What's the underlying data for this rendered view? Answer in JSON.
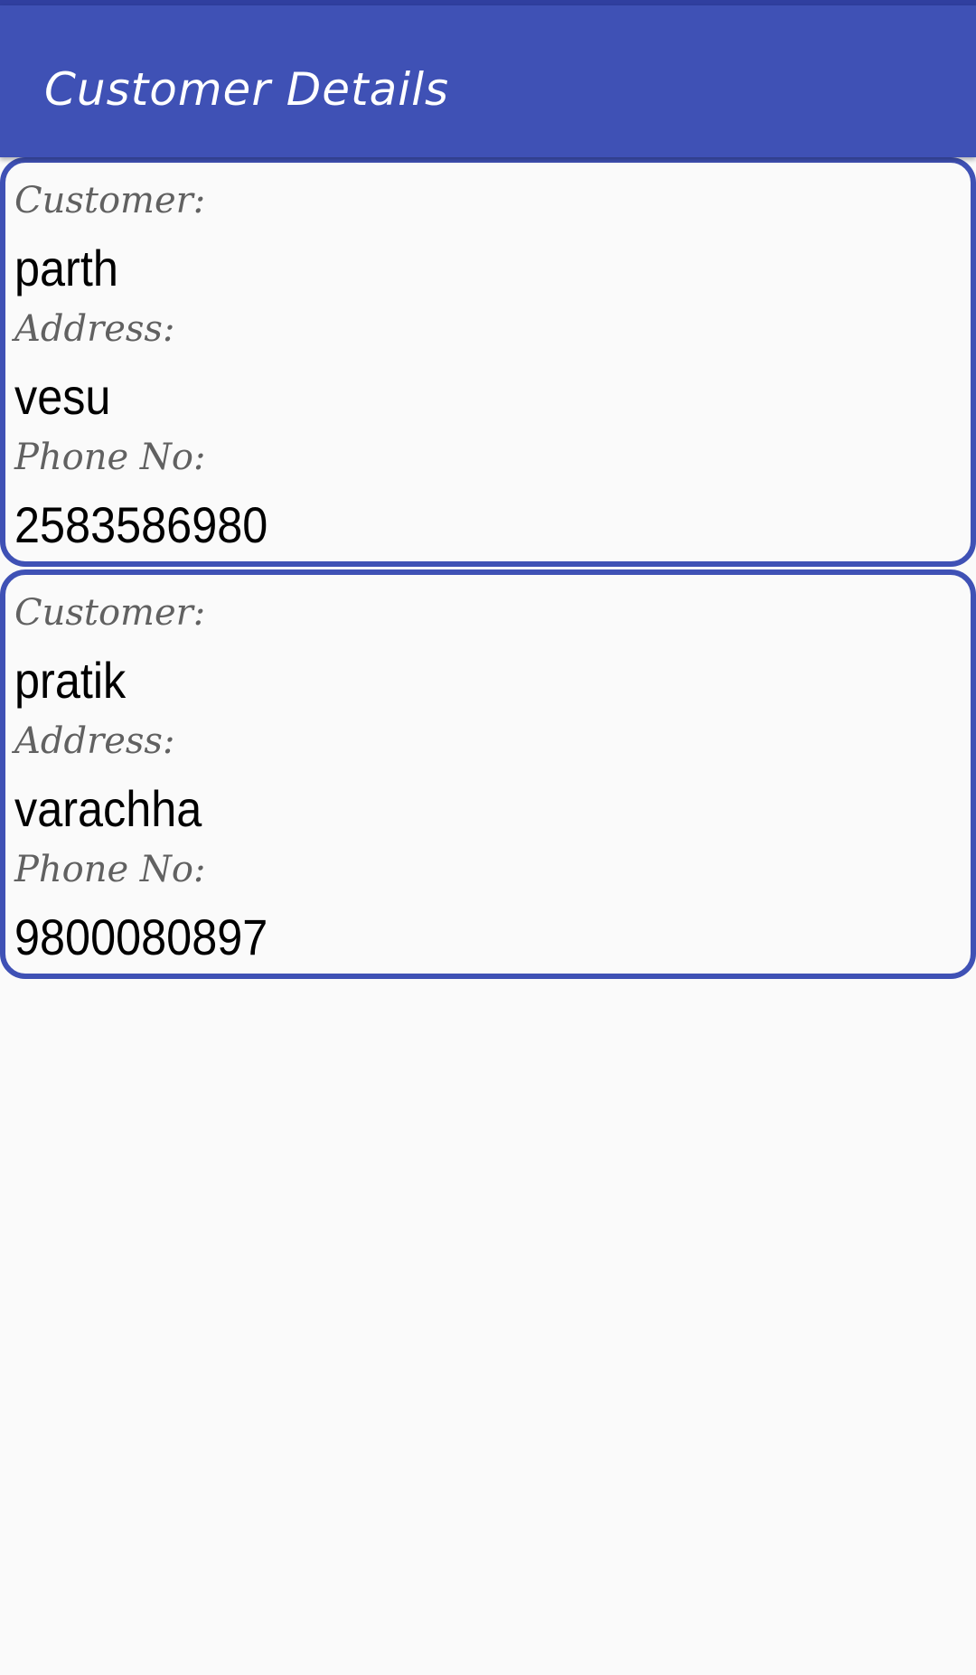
{
  "app_bar": {
    "title": "Customer Details",
    "color": "#3f51b5",
    "status_bar_color": "#303f9f"
  },
  "labels": {
    "customer": "Customer:",
    "address": "Address:",
    "phone": "Phone No:"
  },
  "customers": [
    {
      "name": "parth",
      "address": "vesu",
      "phone": "2583586980"
    },
    {
      "name": "pratik",
      "address": "varachha",
      "phone": "9800080897"
    }
  ]
}
